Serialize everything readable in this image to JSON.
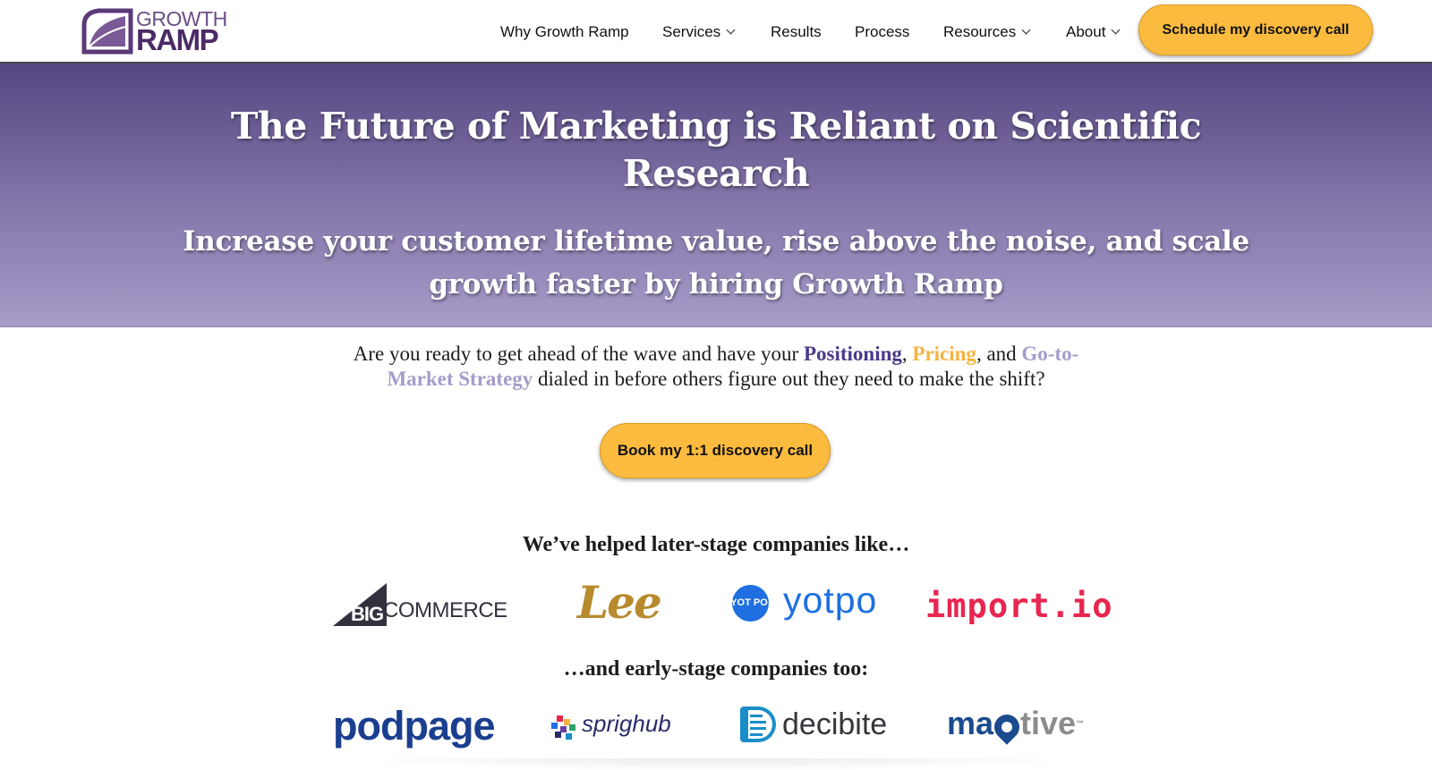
{
  "brand": {
    "logo_text_top": "GROWTH",
    "logo_text_bottom": "RAMP",
    "logo_color": "#5a3a78"
  },
  "nav": {
    "items": [
      {
        "label": "Why Growth Ramp",
        "dropdown": false
      },
      {
        "label": "Services",
        "dropdown": true
      },
      {
        "label": "Results",
        "dropdown": false
      },
      {
        "label": "Process",
        "dropdown": false
      },
      {
        "label": "Resources",
        "dropdown": true
      },
      {
        "label": "About",
        "dropdown": true
      }
    ],
    "cta_label": "Schedule my discovery call"
  },
  "hero": {
    "title": "The Future of Marketing is Reliant on Scientific Research",
    "subtitle": "Increase your customer lifetime value, rise above the noise, and scale growth faster by hiring Growth Ramp",
    "gradient_top": "#554781",
    "gradient_bottom": "#a69bc9"
  },
  "intro": {
    "part1": "Are you ready to get ahead of the wave and have your ",
    "highlight1": "Positioning",
    "sep1": ", ",
    "highlight2": "Pricing",
    "sep2": ", and ",
    "highlight3": "Go-to-Market Strategy",
    "part2": " dialed in before others figure out they need to make the shift?",
    "cta_label": "Book my 1:1 discovery call"
  },
  "colors": {
    "accent": "#fbbb3f",
    "positioning": "#4b3a8a",
    "pricing": "#f6b340",
    "gtm": "#a59cca"
  },
  "later_stage": {
    "heading": "We’ve helped later-stage companies like…",
    "logos": [
      {
        "name": "bigcommerce",
        "big": "BIG",
        "rest": "COMMERCE"
      },
      {
        "name": "lee",
        "text": "Lee"
      },
      {
        "name": "yotpo",
        "badge": "YOT PO.",
        "text": "yotpo"
      },
      {
        "name": "import.io",
        "text": "import.io"
      }
    ]
  },
  "early_stage": {
    "heading": "…and early-stage companies too:",
    "logos": [
      {
        "name": "podpage",
        "text": "podpage"
      },
      {
        "name": "sprighub",
        "text": "sprighub"
      },
      {
        "name": "decibite",
        "text": "decibite"
      },
      {
        "name": "maptive",
        "text_a": "ma",
        "text_b": "tive",
        "mark": "™"
      }
    ]
  }
}
